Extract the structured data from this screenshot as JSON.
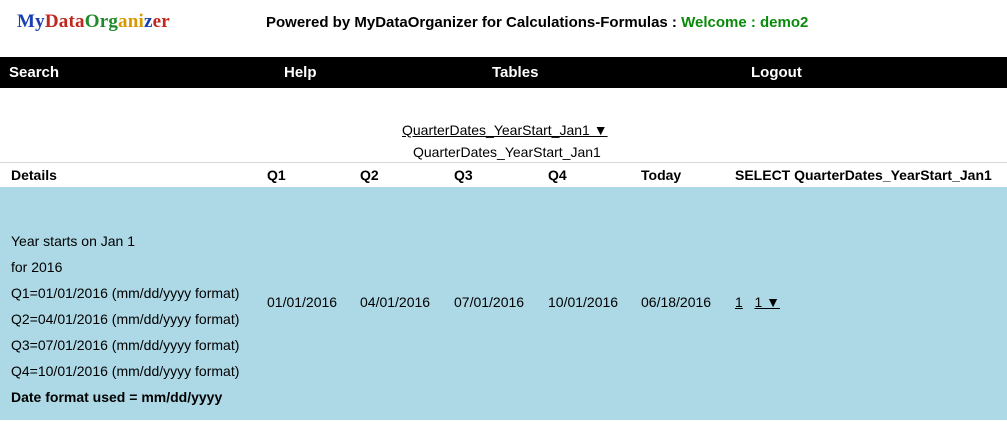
{
  "logo": {
    "letters": [
      "M",
      "y",
      "D",
      "a",
      "t",
      "a",
      "O",
      "r",
      "g",
      "a",
      "n",
      "i",
      "z",
      "e",
      "r"
    ],
    "colors": [
      "#1a3fb0",
      "#1a3fb0",
      "#c0271f",
      "#c0271f",
      "#c0271f",
      "#c0271f",
      "#1f8a2a",
      "#1f8a2a",
      "#1f8a2a",
      "#d69a00",
      "#d69a00",
      "#d69a00",
      "#1a3fb0",
      "#c0271f",
      "#c0271f"
    ]
  },
  "header": {
    "powered_text": "Powered by MyDataOrganizer for Calculations-Formulas : ",
    "welcome_text": "Welcome : demo2",
    "welcome_color": "#0a8a0a"
  },
  "nav": {
    "search": "Search",
    "help": "Help",
    "tables": "Tables",
    "logout": "Logout"
  },
  "table_select": {
    "link_text": "QuarterDates_YearStart_Jan1 ▼",
    "subtitle": "QuarterDates_YearStart_Jan1"
  },
  "table": {
    "headers": [
      "Details",
      "Q1",
      "Q2",
      "Q3",
      "Q4",
      "Today",
      "SELECT QuarterDates_YearStart_Jan1"
    ],
    "row": {
      "details_lines": [
        "Year starts on Jan 1",
        "for 2016",
        "Q1=01/01/2016 (mm/dd/yyyy format)",
        "Q2=04/01/2016 (mm/dd/yyyy format)",
        "Q3=07/01/2016 (mm/dd/yyyy format)",
        "Q4=10/01/2016 (mm/dd/yyyy format)"
      ],
      "details_bold": "Date format used = mm/dd/yyyy",
      "q1": "01/01/2016",
      "q2": "04/01/2016",
      "q3": "07/01/2016",
      "q4": "10/01/2016",
      "today": "06/18/2016",
      "select_link1": "1",
      "select_link2": "1 ▼"
    },
    "row_color": "#add8e6"
  }
}
